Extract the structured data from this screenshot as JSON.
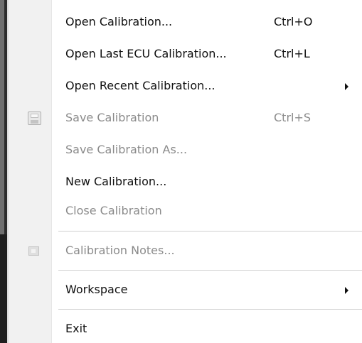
{
  "menu": {
    "items": [
      {
        "label": "Open Calibration...",
        "shortcut": "Ctrl+O",
        "enabled": true
      },
      {
        "label": "Open Last ECU Calibration...",
        "shortcut": "Ctrl+L",
        "enabled": true
      },
      {
        "label": "Open Recent Calibration...",
        "shortcut": "",
        "enabled": true,
        "submenu": true
      },
      {
        "label": "Save Calibration",
        "shortcut": "Ctrl+S",
        "enabled": false,
        "icon": "save-disk-icon"
      },
      {
        "label": "Save Calibration As...",
        "shortcut": "",
        "enabled": false
      },
      {
        "label": "New Calibration...",
        "shortcut": "",
        "enabled": true
      },
      {
        "label": "Close Calibration",
        "shortcut": "",
        "enabled": false
      },
      {
        "label": "Calibration Notes...",
        "shortcut": "",
        "enabled": false,
        "icon": "notes-icon"
      },
      {
        "label": "Workspace",
        "shortcut": "",
        "enabled": true,
        "submenu": true
      },
      {
        "label": "Exit",
        "shortcut": "",
        "enabled": true
      }
    ],
    "arrow_icon": "submenu-arrow-icon"
  }
}
